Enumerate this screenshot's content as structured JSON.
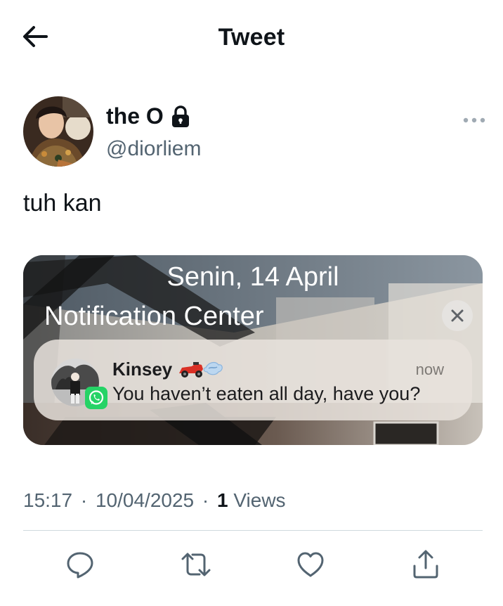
{
  "header": {
    "title": "Tweet",
    "back_icon": "arrow-left-icon"
  },
  "author": {
    "name": "the O",
    "handle": "@diorliem",
    "protected_icon": "lock-icon",
    "more_icon": "more-horizontal-icon"
  },
  "tweet": {
    "text": "tuh kan"
  },
  "media": {
    "lock_screen_date": "Senin, 14 April",
    "notification_center_title": "Notification Center",
    "clear_icon": "close-icon",
    "notification": {
      "sender": "Kinsey",
      "sender_emoji": "🏎️💨",
      "time": "now",
      "message": "You haven’t eaten all day, have you?",
      "app_icon": "whatsapp-icon"
    }
  },
  "meta": {
    "time": "15:17",
    "date": "10/04/2025",
    "views_count": "1",
    "views_label": "Views",
    "separator": "·"
  },
  "actions": [
    {
      "icon": "reply-icon"
    },
    {
      "icon": "retweet-icon"
    },
    {
      "icon": "like-icon"
    },
    {
      "icon": "share-icon"
    }
  ],
  "colors": {
    "primary_text": "#0f1419",
    "secondary_text": "#536471",
    "divider": "#cfd9de",
    "whatsapp_green": "#25d366"
  }
}
